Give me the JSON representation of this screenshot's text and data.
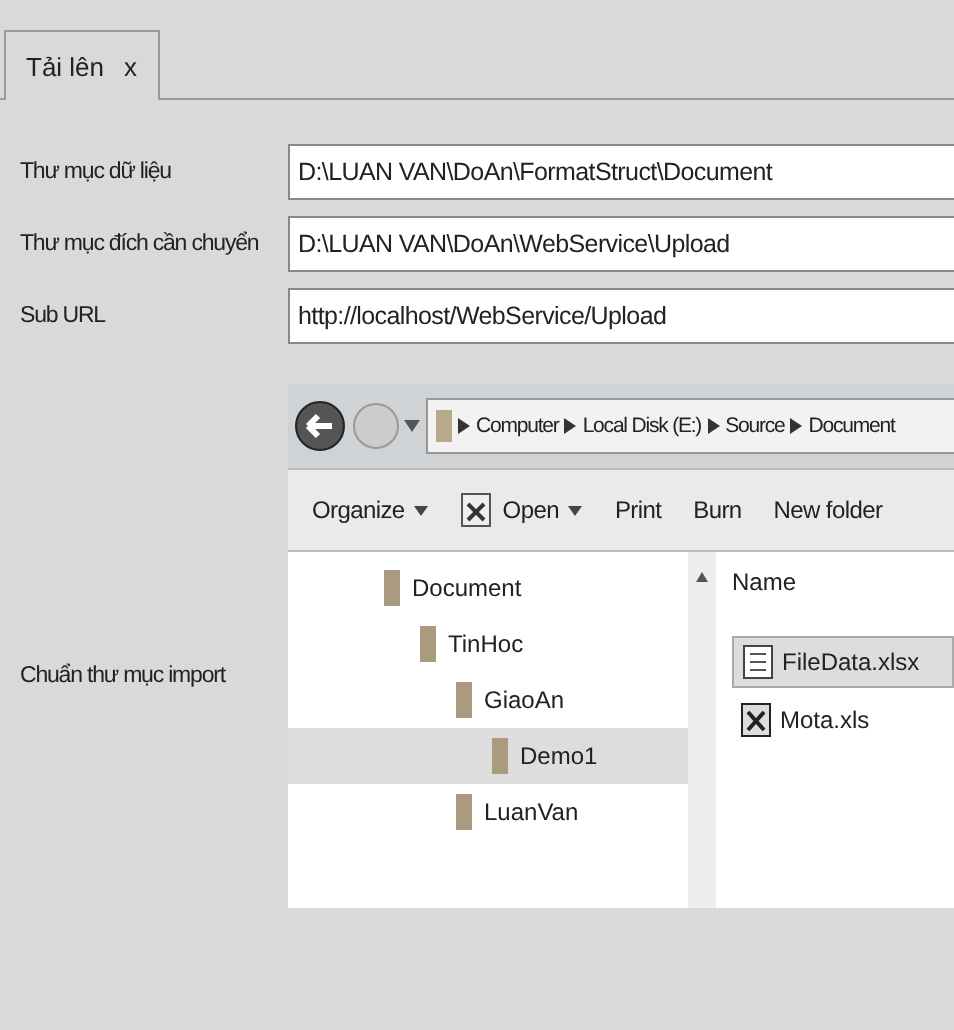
{
  "tabs": [
    {
      "label": "Tải lên",
      "close": "x",
      "selected": true
    }
  ],
  "fields": [
    {
      "label": "Thư mục dữ liệu",
      "value": "D:\\LUAN VAN\\DoAn\\FormatStruct\\Document"
    },
    {
      "label": "Thư mục đích cần chuyển",
      "value": "D:\\LUAN VAN\\DoAn\\WebService\\Upload"
    },
    {
      "label": "Sub URL",
      "value": "http://localhost/WebService/Upload"
    }
  ],
  "import_label": "Chuẩn thư mục import",
  "explorer": {
    "breadcrumb": [
      "Computer",
      "Local Disk (E:)",
      "Source",
      "Document"
    ],
    "toolbar": [
      {
        "label": "Organize",
        "dropdown": true,
        "icon": false
      },
      {
        "label": "Open",
        "dropdown": true,
        "icon": true
      },
      {
        "label": "Print",
        "dropdown": false,
        "icon": false
      },
      {
        "label": "Burn",
        "dropdown": false,
        "icon": false
      },
      {
        "label": "New folder",
        "dropdown": false,
        "icon": false
      }
    ],
    "tree": [
      {
        "label": "Document",
        "selected": false,
        "children": [
          {
            "label": "TinHoc",
            "selected": false,
            "children": [
              {
                "label": "GiaoAn",
                "selected": false,
                "children": [
                  {
                    "label": "Demo1",
                    "selected": true
                  }
                ]
              },
              {
                "label": "LuanVan",
                "selected": false
              }
            ]
          }
        ]
      }
    ],
    "column": "Name",
    "files": [
      {
        "name": "FileData.xlsx",
        "kind": "xlsx",
        "selected": true
      },
      {
        "name": "Mota.xls",
        "kind": "xls",
        "selected": false
      }
    ]
  }
}
